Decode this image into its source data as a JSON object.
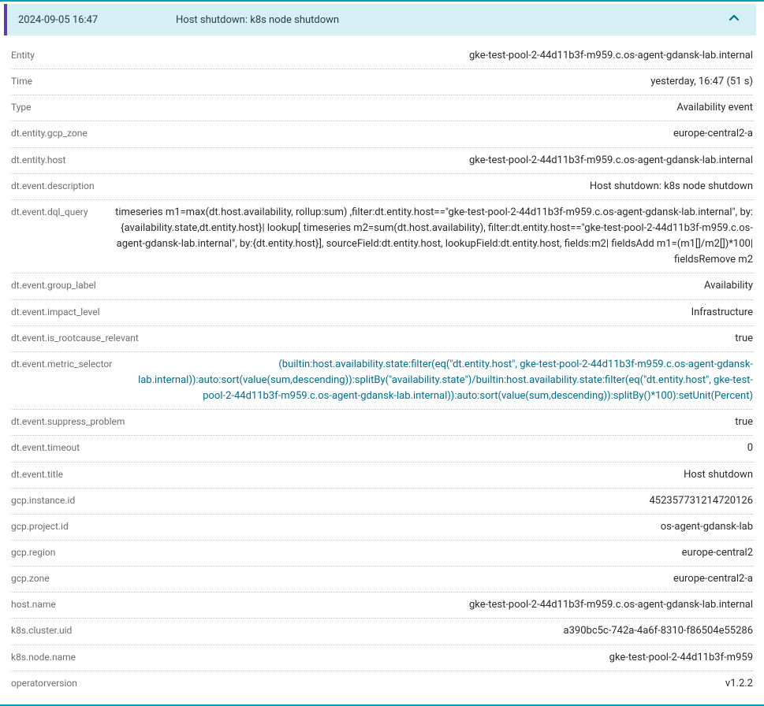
{
  "header": {
    "date": "2024-09-05 16:47",
    "title": "Host shutdown: k8s node shutdown"
  },
  "rows": [
    {
      "label": "Entity",
      "value": "gke-test-pool-2-44d11b3f-m959.c.os-agent-gdansk-lab.internal",
      "link": false
    },
    {
      "label": "Time",
      "value": "yesterday, 16:47 (51 s)",
      "link": false
    },
    {
      "label": "Type",
      "value": "Availability event",
      "link": false
    },
    {
      "label": "dt.entity.gcp_zone",
      "value": "europe-central2-a",
      "link": false
    },
    {
      "label": "dt.entity.host",
      "value": "gke-test-pool-2-44d11b3f-m959.c.os-agent-gdansk-lab.internal",
      "link": false
    },
    {
      "label": "dt.event.description",
      "value": "Host shutdown: k8s node shutdown",
      "link": false
    },
    {
      "label": "dt.event.dql_query",
      "value": "timeseries m1=max(dt.host.availability, rollup:sum) ,filter:dt.entity.host==\"gke-test-pool-2-44d11b3f-m959.c.os-agent-gdansk-lab.internal\", by:{availability.state,dt.entity.host}| lookup[ timeseries m2=sum(dt.host.availability), filter:dt.entity.host==\"gke-test-pool-2-44d11b3f-m959.c.os-agent-gdansk-lab.internal\", by:{dt.entity.host}], sourceField:dt.entity.host, lookupField:dt.entity.host, fields:m2| fieldsAdd m1=(m1[]/m2[])*100| fieldsRemove m2",
      "link": false
    },
    {
      "label": "dt.event.group_label",
      "value": "Availability",
      "link": false
    },
    {
      "label": "dt.event.impact_level",
      "value": "Infrastructure",
      "link": false
    },
    {
      "label": "dt.event.is_rootcause_relevant",
      "value": "true",
      "link": false
    },
    {
      "label": "dt.event.metric_selector",
      "value": "(builtin:host.availability.state:filter(eq(\"dt.entity.host\", gke-test-pool-2-44d11b3f-m959.c.os-agent-gdansk-lab.internal)):auto:sort(value(sum,descending)):splitBy(\"availability.state\")/builtin:host.availability.state:filter(eq(\"dt.entity.host\", gke-test-pool-2-44d11b3f-m959.c.os-agent-gdansk-lab.internal)):auto:sort(value(sum,descending)):splitBy()*100):setUnit(Percent)",
      "link": true
    },
    {
      "label": "dt.event.suppress_problem",
      "value": "true",
      "link": false
    },
    {
      "label": "dt.event.timeout",
      "value": "0",
      "link": false
    },
    {
      "label": "dt.event.title",
      "value": "Host shutdown",
      "link": false
    },
    {
      "label": "gcp.instance.id",
      "value": "452357731214720126",
      "link": false
    },
    {
      "label": "gcp.project.id",
      "value": "os-agent-gdansk-lab",
      "link": false
    },
    {
      "label": "gcp.region",
      "value": "europe-central2",
      "link": false
    },
    {
      "label": "gcp.zone",
      "value": "europe-central2-a",
      "link": false
    },
    {
      "label": "host.name",
      "value": "gke-test-pool-2-44d11b3f-m959.c.os-agent-gdansk-lab.internal",
      "link": false
    },
    {
      "label": "k8s.cluster.uid",
      "value": "a390bc5c-742a-4a6f-8310-f86504e55286",
      "link": false
    },
    {
      "label": "k8s.node.name",
      "value": "gke-test-pool-2-44d11b3f-m959",
      "link": false
    },
    {
      "label": "operatorversion",
      "value": "v1.2.2",
      "link": false
    }
  ]
}
